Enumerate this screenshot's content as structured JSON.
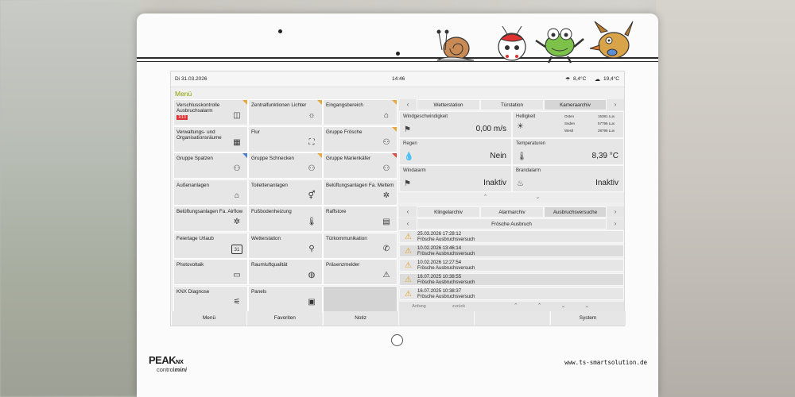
{
  "statusbar": {
    "date": "Di  31.03.2026",
    "time": "14:46",
    "humidity": "8,4°C",
    "outdoor_temp": "19,4°C"
  },
  "menu": {
    "title": "Menü"
  },
  "tiles": [
    {
      "label": "Verschlusskontrolle Ausbruchsalarm",
      "badge": "1/13",
      "icon": "door-icon",
      "glyph": "◫",
      "flag": "orange"
    },
    {
      "label": "Zentralfunktionen Lichter",
      "icon": "light-icon",
      "glyph": "☼",
      "flag": "orange"
    },
    {
      "label": "Eingangsbereich",
      "icon": "house-icon",
      "glyph": "⌂",
      "flag": "orange"
    },
    {
      "label": "Verwaltungs- und Organisationsräume",
      "icon": "window-icon",
      "glyph": "▦",
      "flag": ""
    },
    {
      "label": "Flur",
      "icon": "stairs-icon",
      "glyph": "⛶",
      "flag": ""
    },
    {
      "label": "Gruppe Frösche",
      "icon": "frog-group-icon",
      "glyph": "⚇",
      "flag": "orange"
    },
    {
      "label": "Gruppe Spatzen",
      "icon": "sparrow-group-icon",
      "glyph": "⚇",
      "flag": "blue"
    },
    {
      "label": "Gruppe Schnecken",
      "icon": "snail-group-icon",
      "glyph": "⚇",
      "flag": "orange"
    },
    {
      "label": "Gruppe Marienkäfer",
      "icon": "ladybug-group-icon",
      "glyph": "⚇",
      "flag": "red"
    },
    {
      "label": "Außenanlagen",
      "icon": "outdoor-icon",
      "glyph": "⌂",
      "flag": ""
    },
    {
      "label": "Toilettenanlagen",
      "icon": "toilet-icon",
      "glyph": "⚥",
      "flag": ""
    },
    {
      "label": "Belüftungsanlagen Fa. Meltem",
      "icon": "fan-icon",
      "glyph": "✲",
      "flag": ""
    },
    {
      "label": "Belüftungsanlagen Fa. Airflow",
      "icon": "fan-icon",
      "glyph": "✲",
      "flag": ""
    },
    {
      "label": "Fußbodenheizung",
      "icon": "thermometer-icon",
      "glyph": "🌡",
      "flag": ""
    },
    {
      "label": "Raffstore",
      "icon": "blinds-icon",
      "glyph": "▤",
      "flag": ""
    },
    {
      "label": "Feiertage Urlaub",
      "icon": "calendar-icon",
      "glyph": "31",
      "flag": ""
    },
    {
      "label": "Wetterstation",
      "icon": "weather-station-icon",
      "glyph": "⚲",
      "flag": ""
    },
    {
      "label": "Türkommunikation",
      "icon": "phone-icon",
      "glyph": "✆",
      "flag": ""
    },
    {
      "label": "Photovoltaik",
      "icon": "solar-panel-icon",
      "glyph": "▭",
      "flag": ""
    },
    {
      "label": "Raumluftqualität",
      "icon": "air-quality-icon",
      "glyph": "◍",
      "flag": ""
    },
    {
      "label": "Präsenzmelder",
      "icon": "warning-icon",
      "glyph": "⚠",
      "flag": ""
    },
    {
      "label": "KNX Diagnose",
      "icon": "plug-icon",
      "glyph": "⚟",
      "flag": ""
    },
    {
      "label": "Panels",
      "icon": "monitor-icon",
      "glyph": "▣",
      "flag": ""
    }
  ],
  "weather_tabs": [
    "Wetterstation",
    "Türstation",
    "Kameraarchiv"
  ],
  "weather": {
    "wind_label": "Windgeschwindigkeit",
    "wind_value": "0,00 m/s",
    "brightness_label": "Helligkeit",
    "lux": [
      {
        "dir": "Osten",
        "value": "15381 Lux"
      },
      {
        "dir": "Süden",
        "value": "57795 Lux"
      },
      {
        "dir": "Westl",
        "value": "28795 Lux"
      }
    ],
    "rain_label": "Regen",
    "rain_value": "Nein",
    "temp_label": "Temperaturen",
    "temp_value": "8,39 °C",
    "windalarm_label": "Windalarm",
    "windalarm_value": "Inaktiv",
    "firealarm_label": "Brandalarm",
    "firealarm_value": "Inaktiv"
  },
  "archive_tabs": [
    "Klingelarchiv",
    "Alarmarchiv",
    "Ausbruchsversuche"
  ],
  "archive_subtitle": "Frösche Ausbruch",
  "alarms": [
    {
      "time": "25.03.2026 17:28:12",
      "text": "Frösche Ausbruchsversuch"
    },
    {
      "time": "10.02.2026 13:46:14",
      "text": "Frösche Ausbruchsversuch"
    },
    {
      "time": "10.02.2026 12:27:54",
      "text": "Frösche Ausbruchsversuch"
    },
    {
      "time": "16.07.2025 10:38:55",
      "text": "Frösche Ausbruchsversuch"
    },
    {
      "time": "16.07.2025 10:38:37",
      "text": "Frösche Ausbruchsversuch"
    }
  ],
  "archive_nav": {
    "first": "Anfang",
    "back": "zurück"
  },
  "bottom_buttons": [
    "Menü",
    "Favoriten",
    "Notiz",
    "",
    "",
    "System"
  ],
  "branding": {
    "peak": "PEAK",
    "nx": "NX",
    "control": "control",
    "mini": "mini",
    "url": "www.ts-smartsolution.de"
  },
  "colors": {
    "accent": "#8aa000",
    "alarm_warning": "#e3a21c",
    "badge": "#dd3333"
  }
}
